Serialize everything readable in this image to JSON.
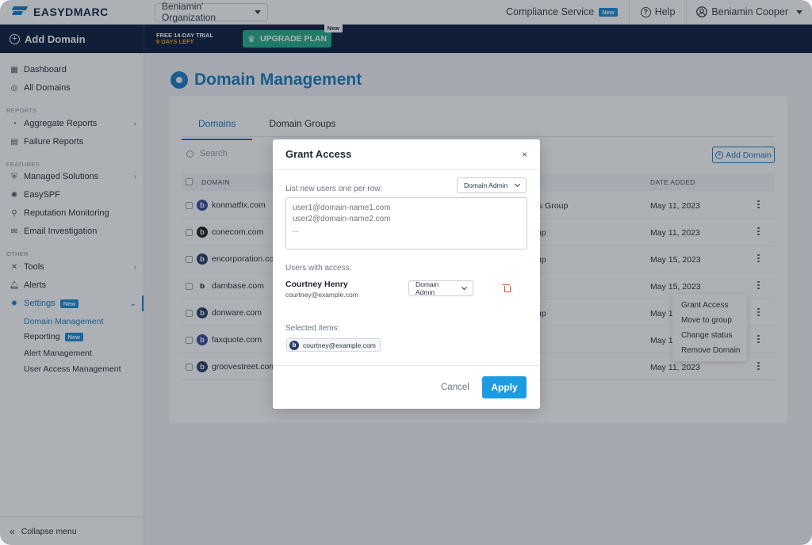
{
  "app": {
    "brand": "EASYDMARC"
  },
  "topbar": {
    "organization": "Beniamin' Organization",
    "compliance_label": "Compliance Service",
    "compliance_badge": "New",
    "help_label": "Help",
    "user_name": "Beniamin Cooper"
  },
  "darkbar": {
    "add_domain": "Add Domain",
    "trial_line1": "FREE 14-DAY TRIAL",
    "trial_line2": "9 DAYS LEFT",
    "upgrade_label": "UPGRADE PLAN",
    "upgrade_badge": "New"
  },
  "sidebar": {
    "dashboard": "Dashboard",
    "all_domains": "All Domains",
    "section_reports": "REPORTS",
    "aggregate_reports": "Aggregate Reports",
    "failure_reports": "Failure Reports",
    "section_features": "FEATURES",
    "managed_solutions": "Managed Solutions",
    "easyspf": "EasySPF",
    "reputation_monitoring": "Reputation Monitoring",
    "email_investigation": "Email Investigation",
    "section_other": "OTHER",
    "tools": "Tools",
    "alerts": "Alerts",
    "settings": "Settings",
    "settings_badge": "New",
    "sub_domain_management": "Domain Management",
    "sub_reporting": "Reporting",
    "sub_reporting_badge": "New",
    "sub_alert_management": "Alert Management",
    "sub_user_access_management": "User Access Management",
    "collapse": "Collapse menu"
  },
  "main": {
    "title": "Domain Management",
    "tabs": [
      "Domains",
      "Domain Groups"
    ],
    "search_placeholder": "Search",
    "add_domain_button": "Add Domain",
    "col_domain": "DOMAIN",
    "col_date": "DATE ADDED",
    "rows": [
      {
        "favicon": "b",
        "favicon_color": "#3b4ea0",
        "domain": "konmatfix.com",
        "group": "'s Group",
        "date": "May 11, 2023"
      },
      {
        "favicon": "b",
        "favicon_color": "#1f2328",
        "domain": "conecom.com",
        "group": "up",
        "date": "May 11, 2023"
      },
      {
        "favicon": "b",
        "favicon_color": "#2a3e6a",
        "domain": "encorporation.com",
        "group": "up",
        "date": "May 15, 2023"
      },
      {
        "favicon": "b",
        "favicon_color": "#ffffff",
        "domain": "dambase.com",
        "group": "",
        "date": "May 15, 2023"
      },
      {
        "favicon": "b",
        "favicon_color": "#2a3e6a",
        "domain": "donware.com",
        "group": "up",
        "date": "May 11"
      },
      {
        "favicon": "b",
        "favicon_color": "#3b4ea0",
        "domain": "faxquote.com",
        "group": "",
        "date": "May 11"
      },
      {
        "favicon": "b",
        "favicon_color": "#2a3e6a",
        "domain": "groovestreet.com",
        "group": "",
        "date": "May 11, 2023"
      }
    ],
    "context_menu": [
      "Grant Access",
      "Move to group",
      "Change status",
      "Remove Domain"
    ]
  },
  "modal": {
    "title": "Grant Access",
    "close": "×",
    "list_label": "List new users one per row:",
    "role_default": "Domain Admin",
    "textarea_placeholder": "user1@domain-name1.com\nuser2@domain-name2.com\n...",
    "users_label": "Users with access:",
    "user_name": "Courtney Henry",
    "user_email": "courtney@example.com",
    "user_role": "Domain Admin",
    "selected_label": "Selected items:",
    "chip_favicon": "b",
    "chip_text": "courtney@example.com",
    "cancel": "Cancel",
    "apply": "Apply"
  },
  "colors": {
    "accent": "#1c7fc4",
    "navy": "#0e2140",
    "upgrade": "#27b08a",
    "apply": "#1c9ce0",
    "danger": "#e0452c"
  }
}
